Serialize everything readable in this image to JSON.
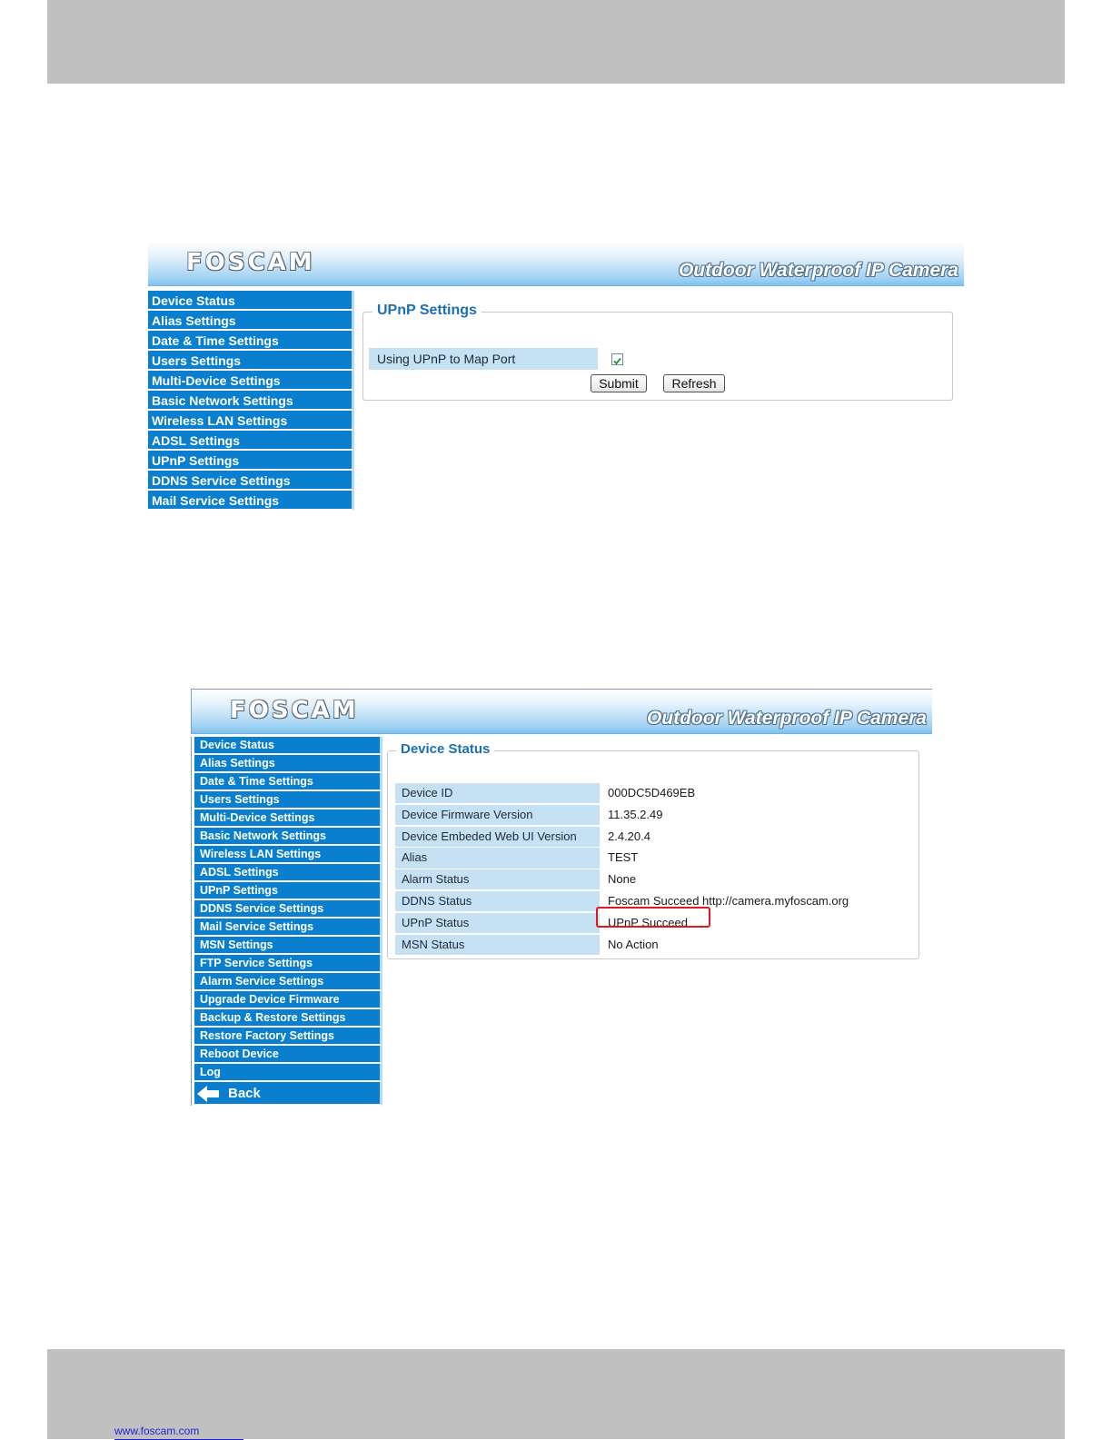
{
  "brand": {
    "logo_text": "FOSCAM",
    "tagline": "Outdoor Waterproof IP Camera"
  },
  "footer": {
    "link_text": "www.foscam.com"
  },
  "colors": {
    "nav_bg": "#0a7fcf",
    "label_bg": "#c6e1f4",
    "legend": "#1a6fb5",
    "highlight": "#e0191c"
  },
  "screen1": {
    "nav": [
      "Device Status",
      "Alias Settings",
      "Date & Time Settings",
      "Users Settings",
      "Multi-Device Settings",
      "Basic Network Settings",
      "Wireless LAN Settings",
      "ADSL Settings",
      "UPnP Settings",
      "DDNS Service Settings",
      "Mail Service Settings"
    ],
    "panel_title": "UPnP Settings",
    "upnp_label": "Using UPnP to Map Port",
    "upnp_checked": true,
    "submit": "Submit",
    "refresh": "Refresh"
  },
  "screen2": {
    "nav": [
      "Device Status",
      "Alias Settings",
      "Date & Time Settings",
      "Users Settings",
      "Multi-Device Settings",
      "Basic Network Settings",
      "Wireless LAN Settings",
      "ADSL Settings",
      "UPnP Settings",
      "DDNS Service Settings",
      "Mail Service Settings",
      "MSN Settings",
      "FTP Service Settings",
      "Alarm Service Settings",
      "Upgrade Device Firmware",
      "Backup & Restore Settings",
      "Restore Factory Settings",
      "Reboot Device",
      "Log"
    ],
    "back": "Back",
    "panel_title": "Device Status",
    "rows": [
      {
        "label": "Device ID",
        "value": "000DC5D469EB"
      },
      {
        "label": "Device Firmware Version",
        "value": "11.35.2.49"
      },
      {
        "label": "Device Embeded Web UI Version",
        "value": "2.4.20.4"
      },
      {
        "label": "Alias",
        "value": "TEST"
      },
      {
        "label": "Alarm Status",
        "value": "None"
      },
      {
        "label": "DDNS Status",
        "value": "Foscam Succeed  http://camera.myfoscam.org"
      },
      {
        "label": "UPnP Status",
        "value": "UPnP Succeed"
      },
      {
        "label": "MSN Status",
        "value": "No Action"
      }
    ]
  }
}
